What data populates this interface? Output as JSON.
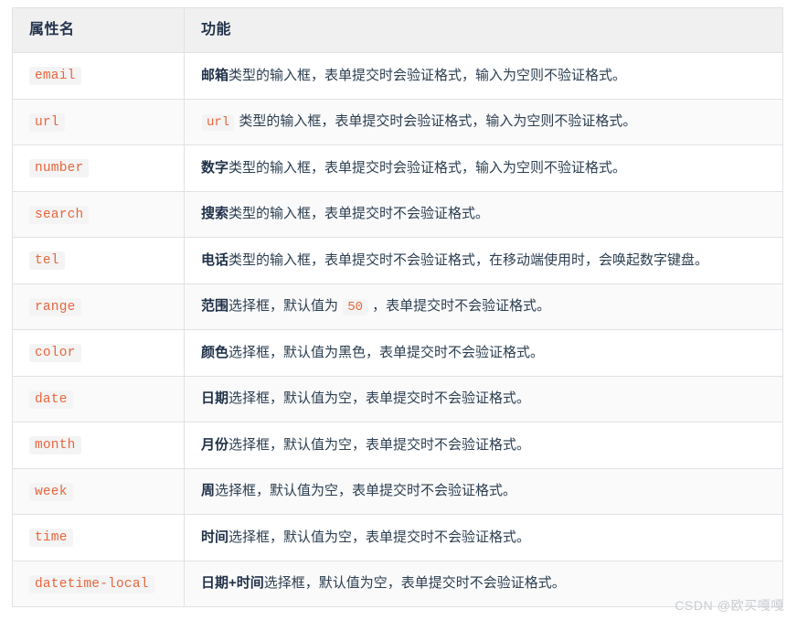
{
  "table": {
    "headers": {
      "name": "属性名",
      "function": "功能"
    },
    "rows": [
      {
        "name": "email",
        "desc_keyword": "邮箱",
        "desc_lead_code": "",
        "desc_parts": [
          "类型的输入框，表单提交时会验证格式，输入为空则不验证格式。"
        ],
        "inline_code": ""
      },
      {
        "name": "url",
        "desc_keyword": "",
        "desc_lead_code": "url",
        "desc_parts": [
          " 类型的输入框，表单提交时会验证格式，输入为空则不验证格式。"
        ],
        "inline_code": ""
      },
      {
        "name": "number",
        "desc_keyword": "数字",
        "desc_lead_code": "",
        "desc_parts": [
          "类型的输入框，表单提交时会验证格式，输入为空则不验证格式。"
        ],
        "inline_code": ""
      },
      {
        "name": "search",
        "desc_keyword": "搜索",
        "desc_lead_code": "",
        "desc_parts": [
          "类型的输入框，表单提交时不会验证格式。"
        ],
        "inline_code": ""
      },
      {
        "name": "tel",
        "desc_keyword": "电话",
        "desc_lead_code": "",
        "desc_parts": [
          "类型的输入框，表单提交时不会验证格式，在移动端使用时，会唤起数字键盘。"
        ],
        "inline_code": ""
      },
      {
        "name": "range",
        "desc_keyword": "范围",
        "desc_lead_code": "",
        "desc_parts": [
          "选择框，默认值为 ",
          " ，表单提交时不会验证格式。"
        ],
        "inline_code": "50"
      },
      {
        "name": "color",
        "desc_keyword": "颜色",
        "desc_lead_code": "",
        "desc_parts": [
          "选择框，默认值为黑色，表单提交时不会验证格式。"
        ],
        "inline_code": ""
      },
      {
        "name": "date",
        "desc_keyword": "日期",
        "desc_lead_code": "",
        "desc_parts": [
          "选择框，默认值为空，表单提交时不会验证格式。"
        ],
        "inline_code": ""
      },
      {
        "name": "month",
        "desc_keyword": "月份",
        "desc_lead_code": "",
        "desc_parts": [
          "选择框，默认值为空，表单提交时不会验证格式。"
        ],
        "inline_code": ""
      },
      {
        "name": "week",
        "desc_keyword": "周",
        "desc_lead_code": "",
        "desc_parts": [
          "选择框，默认值为空，表单提交时不会验证格式。"
        ],
        "inline_code": ""
      },
      {
        "name": "time",
        "desc_keyword": "时间",
        "desc_lead_code": "",
        "desc_parts": [
          "选择框，默认值为空，表单提交时不会验证格式。"
        ],
        "inline_code": ""
      },
      {
        "name": "datetime-local",
        "desc_keyword": "日期+时间",
        "desc_lead_code": "",
        "desc_parts": [
          "选择框，默认值为空，表单提交时不会验证格式。"
        ],
        "inline_code": ""
      }
    ]
  },
  "watermark": {
    "text": "CSDN @欧买嘎嘎"
  },
  "colors": {
    "code_orange": "#e8663d",
    "code_bg": "#f4f4f4",
    "header_bg": "#f0f0f0",
    "border": "#dfe2e5",
    "row_alt_bg": "#fafafa",
    "text": "#2f4156",
    "watermark": "#c9ccd1"
  }
}
